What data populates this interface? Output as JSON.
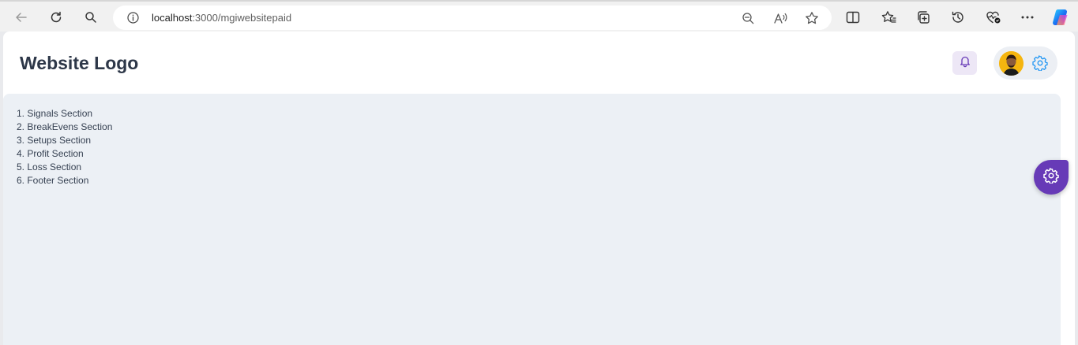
{
  "browser": {
    "url_host": "localhost",
    "url_path": ":3000/mgiwebsitepaid"
  },
  "header": {
    "logo_text": "Website Logo"
  },
  "content": {
    "sections": [
      "1. Signals Section",
      "2. BreakEvens Section",
      "3. Setups Section",
      "4. Profit Section",
      "5. Loss Section",
      "6. Footer Section"
    ]
  },
  "icons": {
    "back": "arrow-left-icon",
    "refresh": "refresh-icon",
    "search": "search-icon",
    "info": "info-icon",
    "zoom_out": "zoom-out-icon",
    "read_aloud": "read-aloud-icon",
    "favorite": "star-icon",
    "split_screen": "split-screen-icon",
    "favorites": "favorites-icon",
    "collections": "collections-icon",
    "history": "history-icon",
    "performance": "heart-pulse-icon",
    "more": "more-icon",
    "copilot": "copilot-icon",
    "notifications": "bell-icon",
    "profile_settings": "gear-icon",
    "customize": "gear-icon"
  },
  "colors": {
    "accent": "#673ab7",
    "bell_bg": "#ede7f6",
    "content_bg": "#ecf0f5",
    "logo_text": "#2d3748",
    "settings_blue": "#2196f3"
  }
}
